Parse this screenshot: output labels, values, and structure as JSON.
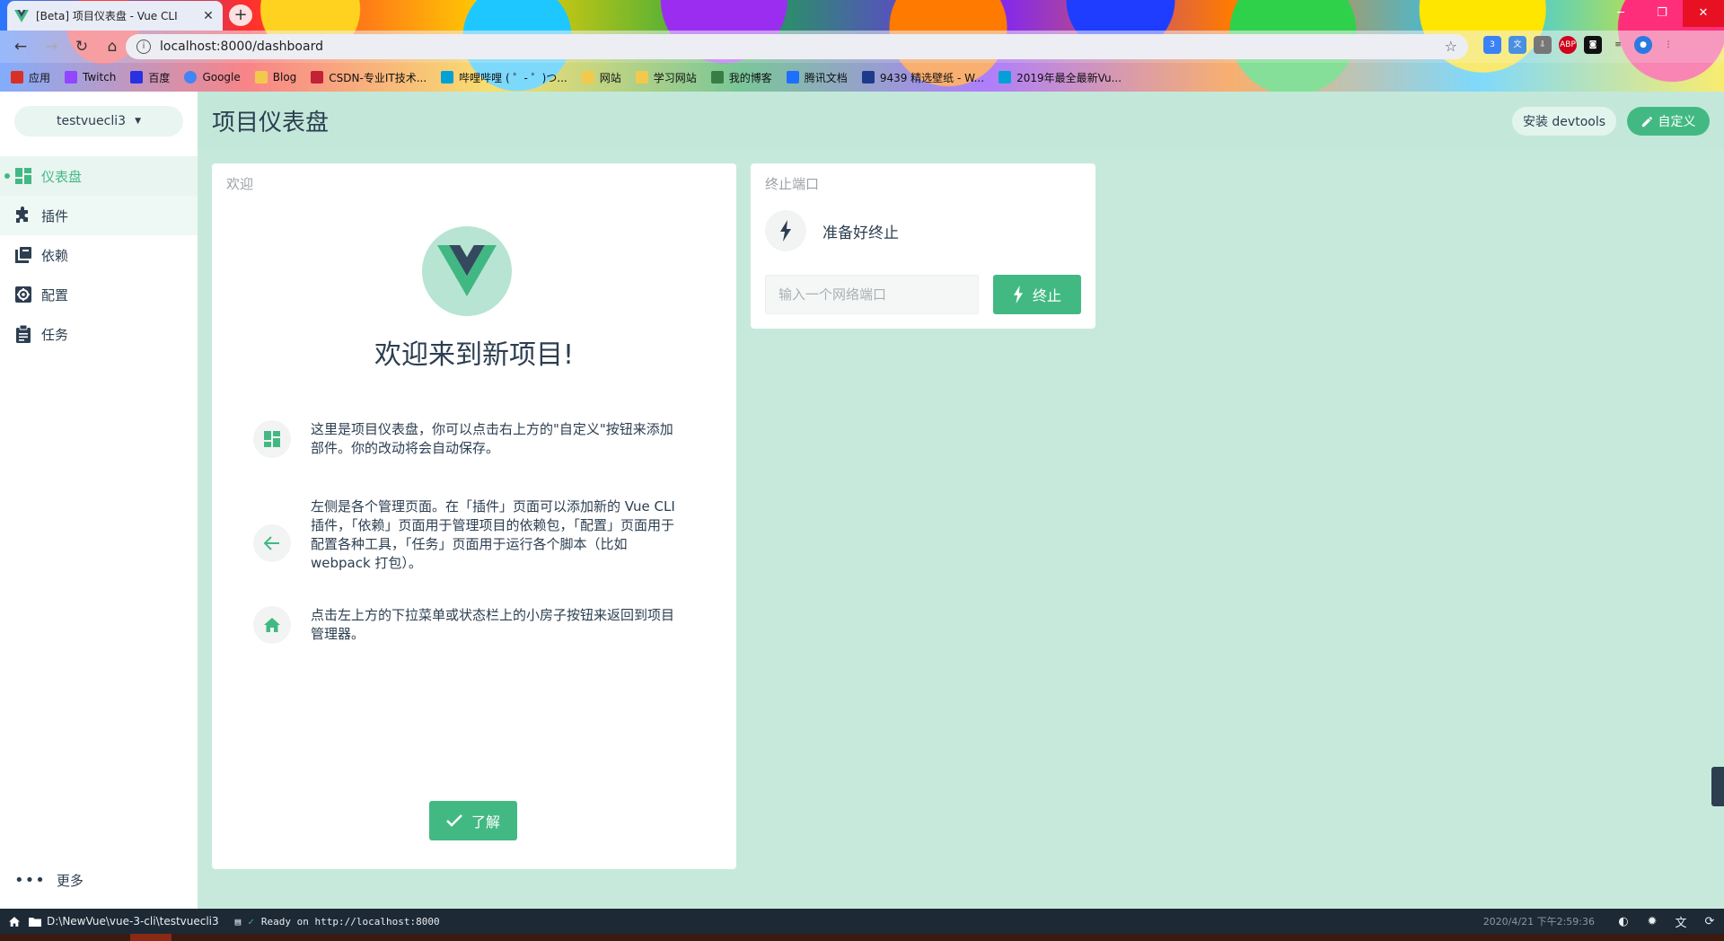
{
  "browser": {
    "tab_title": "[Beta] 项目仪表盘 - Vue CLI",
    "url": "localhost:8000/dashboard",
    "bookmarks": [
      {
        "label": "应用",
        "color": "#d93025"
      },
      {
        "label": "Twitch",
        "color": "#9146ff"
      },
      {
        "label": "百度",
        "color": "#2932e1"
      },
      {
        "label": "Google",
        "color": "#4285f4"
      },
      {
        "label": "Blog",
        "color": "#f2c94c"
      },
      {
        "label": "CSDN-专业IT技术...",
        "color": "#c32136"
      },
      {
        "label": "哔哩哔哩 ( ゜- ゜)つ...",
        "color": "#00a1d6"
      },
      {
        "label": "网站",
        "color": "#f2c94c"
      },
      {
        "label": "学习网站",
        "color": "#f2c94c"
      },
      {
        "label": "我的博客",
        "color": "#3a7d44"
      },
      {
        "label": "腾讯文档",
        "color": "#1e6fff"
      },
      {
        "label": "9439 精选壁纸 - W...",
        "color": "#1e3a8a"
      },
      {
        "label": "2019年最全最新Vu...",
        "color": "#00a1d6"
      }
    ]
  },
  "sidebar": {
    "project_name": "testvuecli3",
    "items": [
      {
        "label": "仪表盘",
        "icon": "dashboard-icon"
      },
      {
        "label": "插件",
        "icon": "puzzle-icon"
      },
      {
        "label": "依赖",
        "icon": "library-icon"
      },
      {
        "label": "配置",
        "icon": "gear-icon"
      },
      {
        "label": "任务",
        "icon": "clipboard-icon"
      }
    ],
    "more_label": "更多"
  },
  "header": {
    "title": "项目仪表盘",
    "devtools_label": "安装 devtools",
    "customize_label": "自定义"
  },
  "welcome": {
    "card_title": "欢迎",
    "heading": "欢迎来到新项目!",
    "tips": [
      {
        "icon": "dashboard-icon",
        "text": "这里是项目仪表盘，你可以点击右上方的\"自定义\"按钮来添加部件。你的改动将会自动保存。"
      },
      {
        "icon": "arrow-left-icon",
        "text": "左侧是各个管理页面。在「插件」页面可以添加新的 Vue CLI 插件，「依赖」页面用于管理项目的依赖包，「配置」页面用于配置各种工具，「任务」页面用于运行各个脚本（比如 webpack 打包）。"
      },
      {
        "icon": "home-icon",
        "text": "点击左上方的下拉菜单或状态栏上的小房子按钮来返回到项目管理器。"
      }
    ],
    "ok_label": "了解"
  },
  "kill_port": {
    "card_title": "终止端口",
    "status": "准备好终止",
    "input_placeholder": "输入一个网络端口",
    "input_value": "",
    "button_label": "终止"
  },
  "statusbar": {
    "path": "D:\\NewVue\\vue-3-cli\\testvuecli3",
    "log": "Ready on http://localhost:8000",
    "time": "2020/4/21 下午2:59:36"
  },
  "colors": {
    "accent": "#42b983",
    "page_bg": "#c6e9dc",
    "text": "#2c3e50",
    "statusbar_bg": "#1d2935"
  }
}
